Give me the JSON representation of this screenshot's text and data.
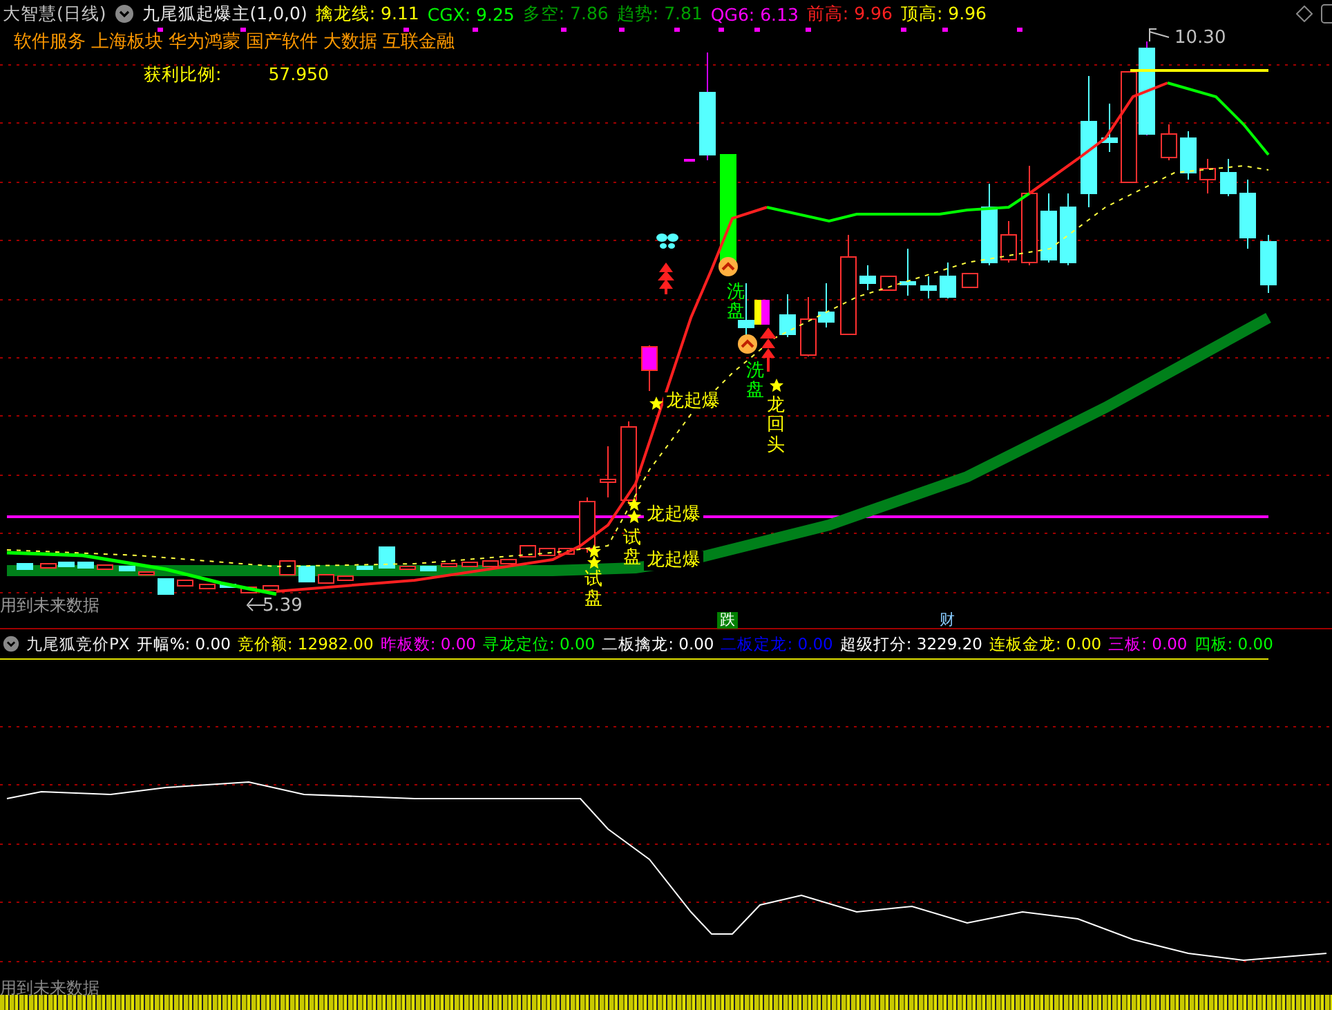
{
  "main_panel": {
    "title": "大智慧(日线)",
    "indicator_name": "九尾狐起爆主(1,0,0)",
    "indicators": [
      {
        "text": "擒龙线: 9.11",
        "color": "#ffff00"
      },
      {
        "text": "CGX: 9.25",
        "color": "#00ff00"
      },
      {
        "text": "多空: 7.86",
        "color": "#00a000"
      },
      {
        "text": "趋势: 7.81",
        "color": "#00a000"
      },
      {
        "text": "QG6: 6.13",
        "color": "#ff00ff"
      },
      {
        "text": "前高: 9.96",
        "color": "#ff2020"
      },
      {
        "text": "顶高: 9.96",
        "color": "#ffff00"
      }
    ],
    "sectors": [
      "软件服务",
      "上海板块",
      "华为鸿蒙",
      "国产软件",
      "大数据",
      "互联金融"
    ],
    "profit_ratio": {
      "label": "获利比例:",
      "value": "57.950"
    },
    "chart_labels": [
      {
        "kind": "price",
        "text": "10.30"
      },
      {
        "kind": "price",
        "text": "5.39"
      },
      {
        "kind": "signal",
        "text": "龙起爆"
      },
      {
        "kind": "signal",
        "text": "龙起爆"
      },
      {
        "kind": "signal",
        "text": "龙起爆"
      },
      {
        "kind": "test",
        "text": "试盘"
      },
      {
        "kind": "test",
        "text": "试盘"
      },
      {
        "kind": "wash",
        "text": "洗盘"
      },
      {
        "kind": "wash",
        "text": "洗盘"
      },
      {
        "kind": "dragon",
        "text": "龙回头"
      },
      {
        "kind": "warning",
        "text": "用到未来数据"
      },
      {
        "kind": "fall",
        "text": "跌"
      },
      {
        "kind": "wealth",
        "text": "财"
      }
    ]
  },
  "sub_panel": {
    "indicator_name": "九尾狐竞价PX",
    "values": [
      {
        "text": "开幅%: 0.00",
        "color": "#ffffff"
      },
      {
        "text": "竞价额: 12982.00",
        "color": "#ffff00"
      },
      {
        "text": "昨板数: 0.00",
        "color": "#ff00ff"
      },
      {
        "text": "寻龙定位: 0.00",
        "color": "#00ff00"
      },
      {
        "text": "二板擒龙: 0.00",
        "color": "#ffffff"
      },
      {
        "text": "二板定龙: 0.00",
        "color": "#0000ff"
      },
      {
        "text": "超级打分: 3229.20",
        "color": "#ffffff"
      },
      {
        "text": "连板金龙: 0.00",
        "color": "#ffff00"
      },
      {
        "text": "三板: 0.00",
        "color": "#ff00ff"
      },
      {
        "text": "四板: 0.00",
        "color": "#00ff00"
      }
    ],
    "footer_note": "用到未来数据"
  }
}
